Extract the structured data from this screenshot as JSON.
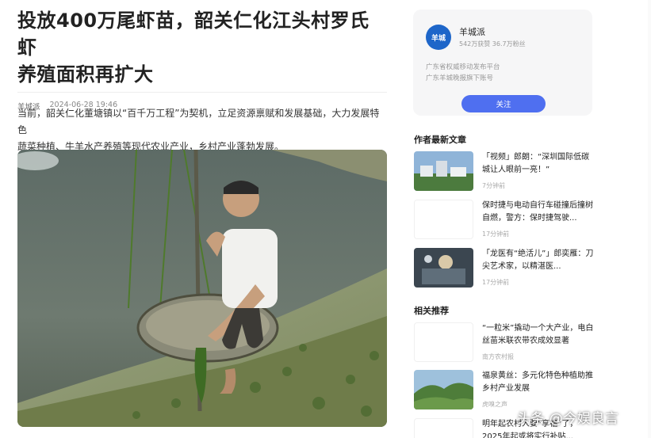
{
  "article": {
    "title_line1": "投放400万尾虾苗，韶关仁化江头村罗氏虾",
    "title_line2": "养殖面积再扩大",
    "author": "羊城派",
    "date": "2024-06-28 19:46",
    "lead_line1": "当前，韶关仁化董塘镇以“百千万工程”为契机，立足资源禀赋和发展基础，大力发展特色",
    "lead_line2": "蔬菜种植、牛羊水产养殖等现代农业产业，乡村产业蓬勃发展。"
  },
  "sidebar": {
    "author_card": {
      "avatar_text": "羊城",
      "name": "羊城派",
      "stats": "542万获赞 36.7万粉丝",
      "desc_line1": "广东省权威移动发布平台",
      "desc_line2": "广东羊城晚报旗下账号",
      "follow_label": "关注"
    },
    "latest_title": "作者最新文章",
    "latest": [
      {
        "title": "「视频」郎朗：“深圳国际低碳城让人眼前一亮！”",
        "time": "7分钟前"
      },
      {
        "title": "保时捷与电动自行车碰撞后撞树自燃，警方：保时捷驾驶...",
        "time": "17分钟前"
      },
      {
        "title": "「龙医有“绝活儿”」郎奕雁：刀尖艺术家，以精湛医...",
        "time": "17分钟前"
      }
    ],
    "related_title": "相关推荐",
    "related": [
      {
        "title": "“一粒米”撬动一个大产业，电白丝苗米联农带农成效显著",
        "source": "南方农村报"
      },
      {
        "title": "福泉黄丝：多元化特色种植助推乡村产业发展",
        "source": "虎嗅之声"
      },
      {
        "title": "明年起农村人要“享福”了，2025年起或将实行补贴...",
        "source": ""
      }
    ]
  },
  "watermark": "头条 @今娱良言",
  "colors": {
    "accent": "#4f6ff0",
    "brand": "#1e66c9"
  }
}
